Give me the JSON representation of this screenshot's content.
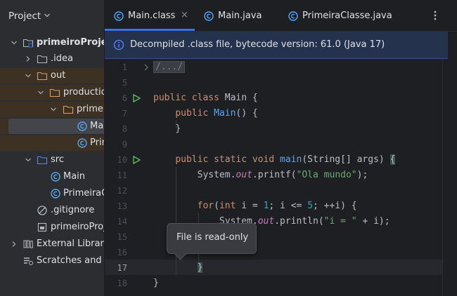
{
  "project_panel": {
    "title": "Project",
    "tree": [
      {
        "label": "primeiroProjeto",
        "icon": "module-folder-icon",
        "bold": true
      },
      {
        "label": ".idea",
        "icon": "folder-icon"
      },
      {
        "label": "out",
        "icon": "folder-icon"
      },
      {
        "label": "production",
        "icon": "folder-icon"
      },
      {
        "label": "primeiroProjeto",
        "icon": "folder-icon"
      },
      {
        "label": "Main",
        "icon": "class-file-icon"
      },
      {
        "label": "PrimeiraClasse",
        "icon": "class-file-icon"
      },
      {
        "label": "src",
        "icon": "source-folder-icon"
      },
      {
        "label": "Main",
        "icon": "java-class-icon"
      },
      {
        "label": "PrimeiraClasse",
        "icon": "java-class-icon"
      },
      {
        "label": ".gitignore",
        "icon": "gitignore-icon"
      },
      {
        "label": "primeiroProjeto.iml",
        "icon": "iml-file-icon"
      },
      {
        "label": "External Libraries",
        "icon": "library-icon"
      },
      {
        "label": "Scratches and Consoles",
        "icon": "scratches-icon"
      }
    ]
  },
  "tabs": [
    {
      "label": "Main.class",
      "active": true,
      "close": "×"
    },
    {
      "label": "Main.java",
      "active": false
    },
    {
      "label": "PrimeiraClasse.java",
      "active": false
    }
  ],
  "banner": {
    "text": "Decompiled .class file, bytecode version: 61.0 (Java 17)"
  },
  "gutter": [
    "1",
    "5",
    "6",
    "7",
    "8",
    "9",
    "10",
    "11",
    "12",
    "13",
    "14",
    "15",
    "16",
    "17",
    "18"
  ],
  "code": {
    "l1": "/.../",
    "l6_kw": "public class ",
    "l6_name": "Main",
    "l6_rest": " {",
    "l7_kw": "public ",
    "l7_fn": "Main",
    "l7_rest": "() {",
    "l8": "}",
    "l10_kw": "public static void ",
    "l10_fn": "main",
    "l10_rest": "(String[] args) ",
    "l10_brace": "{",
    "l11_a": "System.",
    "l11_out": "out",
    "l11_b": ".printf(",
    "l11_str": "\"Ola mundo\"",
    "l11_c": ");",
    "l13_kw1": "for",
    "l13_a": "(",
    "l13_kw2": "int",
    "l13_b": " i = ",
    "l13_n1": "1",
    "l13_c": "; i <= ",
    "l13_n2": "5",
    "l13_d": "; ++i) {",
    "l14_a": "System.",
    "l14_out": "out",
    "l14_b": ".println(",
    "l14_str": "\"i = \"",
    "l14_c": " + i);",
    "l17": "}",
    "l18": "}"
  },
  "tooltip": {
    "text": "File is read-only"
  },
  "colors": {
    "accent": "#3574f0",
    "keyword": "#cf8e6d",
    "function": "#56a8f5",
    "string": "#6aab73",
    "number": "#2aacb8",
    "run": "#5fb865"
  }
}
